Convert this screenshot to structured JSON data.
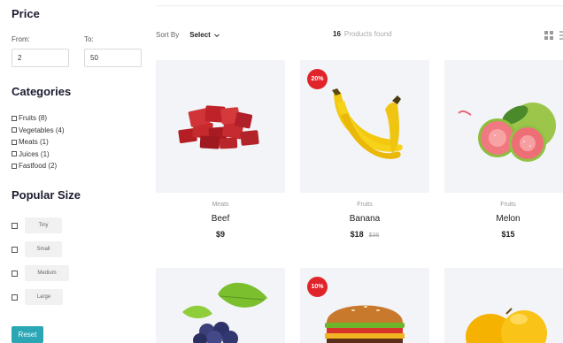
{
  "filters": {
    "price_title": "Price",
    "from_label": "From:",
    "to_label": "To:",
    "from_value": "2",
    "to_value": "50",
    "categories_title": "Categories",
    "categories": [
      {
        "label": "Fruits (8)"
      },
      {
        "label": "Vegetables (4)"
      },
      {
        "label": "Meats (1)"
      },
      {
        "label": "Juices (1)"
      },
      {
        "label": "Fastfood (2)"
      }
    ],
    "size_title": "Popular Size",
    "sizes": [
      {
        "label": "Tiny"
      },
      {
        "label": "Small"
      },
      {
        "label": "Medium"
      },
      {
        "label": "Large"
      }
    ],
    "reset_label": "Reset"
  },
  "toolbar": {
    "sort_label": "Sort By",
    "sort_value": "Select",
    "count": "16",
    "count_label": "Products found",
    "icons": [
      "chevron-down-icon",
      "grid-view-icon",
      "list-view-icon"
    ]
  },
  "products": [
    {
      "category": "Meats",
      "name": "Beef",
      "price": "$9",
      "old_price": "",
      "badge": ""
    },
    {
      "category": "Fruits",
      "name": "Banana",
      "price": "$18",
      "old_price": "$36",
      "badge": "20%"
    },
    {
      "category": "Fruits",
      "name": "Melon",
      "price": "$15",
      "old_price": "",
      "badge": ""
    },
    {
      "badge": ""
    },
    {
      "badge": "10%"
    },
    {
      "badge": ""
    }
  ],
  "colors": {
    "accent": "#2aa6b5",
    "badge": "#e0242a",
    "card_bg": "#f2f4f7"
  }
}
